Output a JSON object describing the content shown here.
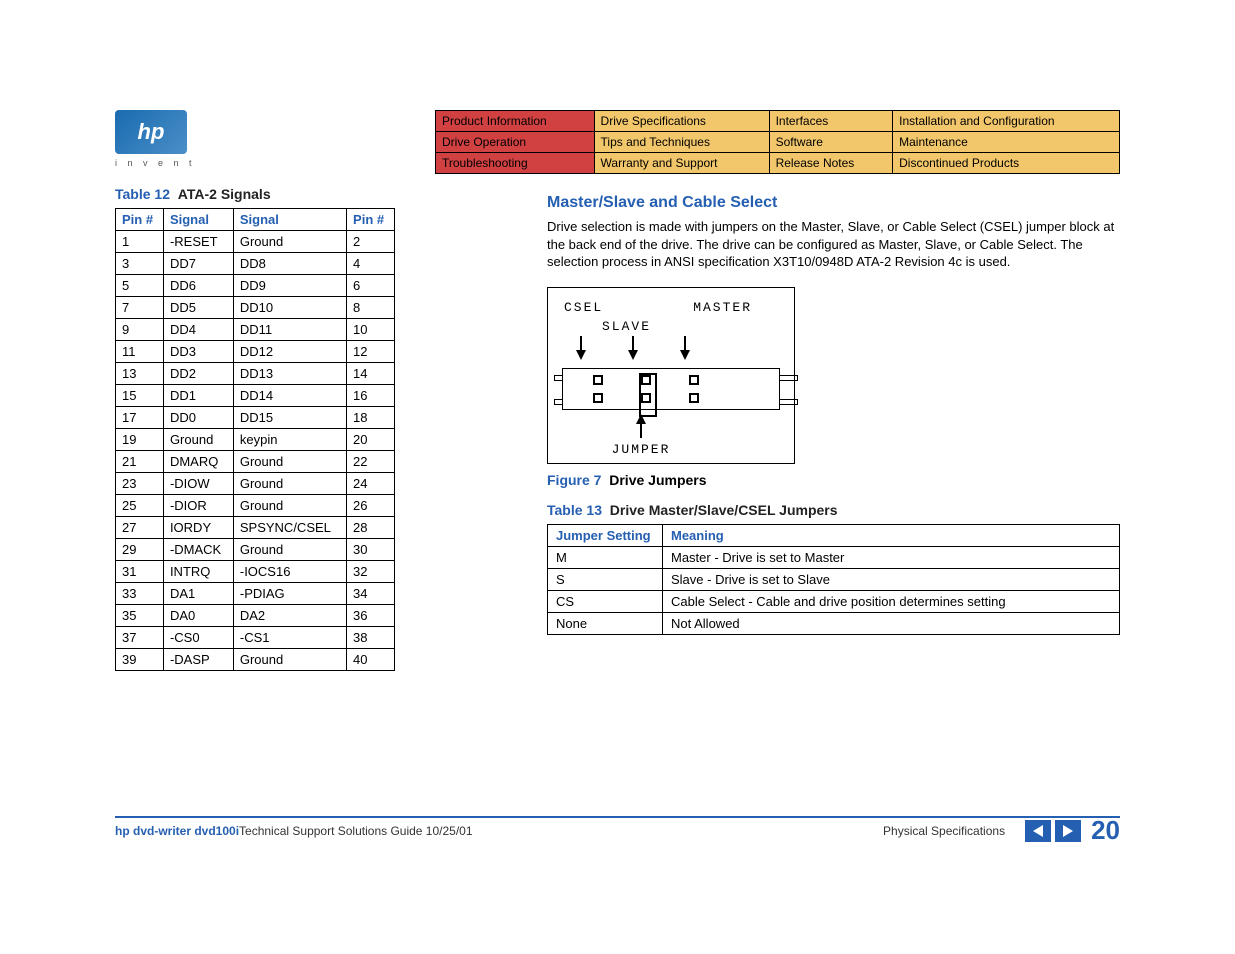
{
  "logo": {
    "text": "hp",
    "tagline": "i n v e n t"
  },
  "nav": [
    [
      "Product Information",
      "Drive Specifications",
      "Interfaces",
      "Installation and Configuration"
    ],
    [
      "Drive Operation",
      "Tips and Techniques",
      "Software",
      "Maintenance"
    ],
    [
      "Troubleshooting",
      "Warranty and Support",
      "Release Notes",
      "Discontinued Products"
    ]
  ],
  "nav_active": [
    [
      0,
      0
    ],
    [
      1,
      0
    ],
    [
      2,
      0
    ]
  ],
  "table12": {
    "label": "Table 12",
    "title": "ATA-2 Signals",
    "headers": [
      "Pin #",
      "Signal",
      "Signal",
      "Pin #"
    ],
    "rows": [
      [
        "1",
        "-RESET",
        "Ground",
        "2"
      ],
      [
        "3",
        "DD7",
        "DD8",
        "4"
      ],
      [
        "5",
        "DD6",
        "DD9",
        "6"
      ],
      [
        "7",
        "DD5",
        "DD10",
        "8"
      ],
      [
        "9",
        "DD4",
        "DD11",
        "10"
      ],
      [
        "11",
        "DD3",
        "DD12",
        "12"
      ],
      [
        "13",
        "DD2",
        "DD13",
        "14"
      ],
      [
        "15",
        "DD1",
        "DD14",
        "16"
      ],
      [
        "17",
        "DD0",
        "DD15",
        "18"
      ],
      [
        "19",
        "Ground",
        "keypin",
        "20"
      ],
      [
        "21",
        "DMARQ",
        "Ground",
        "22"
      ],
      [
        "23",
        "-DIOW",
        "Ground",
        "24"
      ],
      [
        "25",
        "-DIOR",
        "Ground",
        "26"
      ],
      [
        "27",
        "IORDY",
        "SPSYNC/CSEL",
        "28"
      ],
      [
        "29",
        "-DMACK",
        "Ground",
        "30"
      ],
      [
        "31",
        "INTRQ",
        "-IOCS16",
        "32"
      ],
      [
        "33",
        "DA1",
        "-PDIAG",
        "34"
      ],
      [
        "35",
        "DA0",
        "DA2",
        "36"
      ],
      [
        "37",
        "-CS0",
        "-CS1",
        "38"
      ],
      [
        "39",
        "-DASP",
        "Ground",
        "40"
      ]
    ]
  },
  "section": {
    "heading": "Master/Slave and Cable Select",
    "body": "Drive selection is made with jumpers on the Master, Slave, or Cable Select (CSEL) jumper block at the back end of the drive. The drive can be configured as Master, Slave, or Cable Select. The selection process in ANSI specification X3T10/0948D ATA-2 Revision 4c is used."
  },
  "figure7": {
    "label": "Figure 7",
    "title": "Drive Jumpers",
    "labels": {
      "csel": "CSEL",
      "master": "MASTER",
      "slave": "SLAVE",
      "jumper": "JUMPER"
    }
  },
  "table13": {
    "label": "Table 13",
    "title": "Drive Master/Slave/CSEL Jumpers",
    "headers": [
      "Jumper Setting",
      "Meaning"
    ],
    "rows": [
      [
        "M",
        "Master - Drive is set to Master"
      ],
      [
        "S",
        "Slave - Drive is set to Slave"
      ],
      [
        "CS",
        "Cable Select - Cable and drive position determines setting"
      ],
      [
        "None",
        "Not Allowed"
      ]
    ]
  },
  "footer": {
    "title": "hp dvd-writer  dvd100i",
    "subtitle": "  Technical Support Solutions Guide 10/25/01",
    "section": "Physical Specifications",
    "page": "20"
  }
}
